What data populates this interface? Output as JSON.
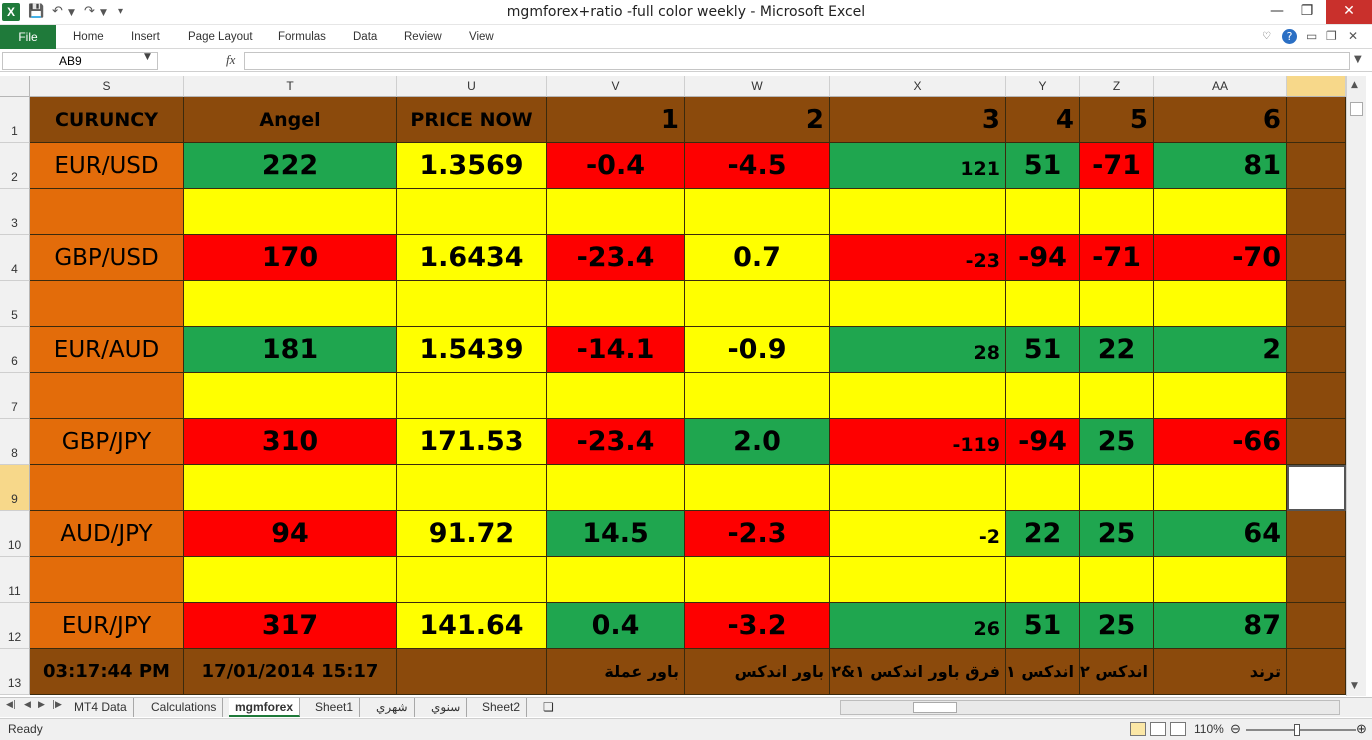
{
  "window": {
    "title": "mgmforex+ratio -full color weekly  -  Microsoft Excel",
    "app_icon": "X",
    "controls": [
      "minimize",
      "restore",
      "close"
    ]
  },
  "ribbon": {
    "file": "File",
    "tabs": [
      "Home",
      "Insert",
      "Page Layout",
      "Formulas",
      "Data",
      "Review",
      "View"
    ]
  },
  "formula_bar": {
    "name_box": "AB9",
    "fx_label": "fx",
    "formula": ""
  },
  "columns": [
    "S",
    "T",
    "U",
    "V",
    "W",
    "X",
    "Y",
    "Z",
    "AA"
  ],
  "rows": [
    "1",
    "2",
    "3",
    "4",
    "5",
    "6",
    "7",
    "8",
    "9",
    "10",
    "11",
    "12",
    "13"
  ],
  "sheet": {
    "header": {
      "currency": "CURUNCY",
      "angel": "Angel",
      "price_now": "PRICE NOW",
      "n1": "1",
      "n2": "2",
      "n3": "3",
      "n4": "4",
      "n5": "5",
      "n6": "6"
    },
    "pairs": [
      {
        "name": "EUR/USD",
        "angel": "222",
        "price": "1.3569",
        "v": "-0.4",
        "w": "-4.5",
        "x": "121",
        "y": "51",
        "z": "-71",
        "aa": "81"
      },
      {
        "name": "GBP/USD",
        "angel": "170",
        "price": "1.6434",
        "v": "-23.4",
        "w": "0.7",
        "x": "-23",
        "y": "-94",
        "z": "-71",
        "aa": "-70"
      },
      {
        "name": "EUR/AUD",
        "angel": "181",
        "price": "1.5439",
        "v": "-14.1",
        "w": "-0.9",
        "x": "28",
        "y": "51",
        "z": "22",
        "aa": "2"
      },
      {
        "name": "GBP/JPY",
        "angel": "310",
        "price": "171.53",
        "v": "-23.4",
        "w": "2.0",
        "x": "-119",
        "y": "-94",
        "z": "25",
        "aa": "-66"
      },
      {
        "name": "AUD/JPY",
        "angel": "94",
        "price": "91.72",
        "v": "14.5",
        "w": "-2.3",
        "x": "-2",
        "y": "22",
        "z": "25",
        "aa": "64"
      },
      {
        "name": "EUR/JPY",
        "angel": "317",
        "price": "141.64",
        "v": "0.4",
        "w": "-3.2",
        "x": "26",
        "y": "51",
        "z": "25",
        "aa": "87"
      }
    ],
    "footer": {
      "time": "03:17:44 PM",
      "datetime": "17/01/2014 15:17",
      "v": "باور عملة",
      "w": "باور اندكس",
      "x": "فرق باور اندكس ١&٢",
      "y": "اندكس ١",
      "z": "اندكس ٢",
      "aa": "ترند"
    }
  },
  "sheet_tabs": [
    "MT4 Data",
    "Calculations",
    "mgmforex",
    "Sheet1",
    "شهري",
    "سنوي",
    "Sheet2"
  ],
  "active_sheet": "mgmforex",
  "status": {
    "ready": "Ready",
    "zoom": "110%"
  },
  "colors": {
    "brown": "#8b4a0c",
    "orange": "#e36c0a",
    "green": "#1fa64f",
    "red": "#fe0000",
    "yellow": "#ffff00",
    "excel_green": "#1f7a3a"
  }
}
